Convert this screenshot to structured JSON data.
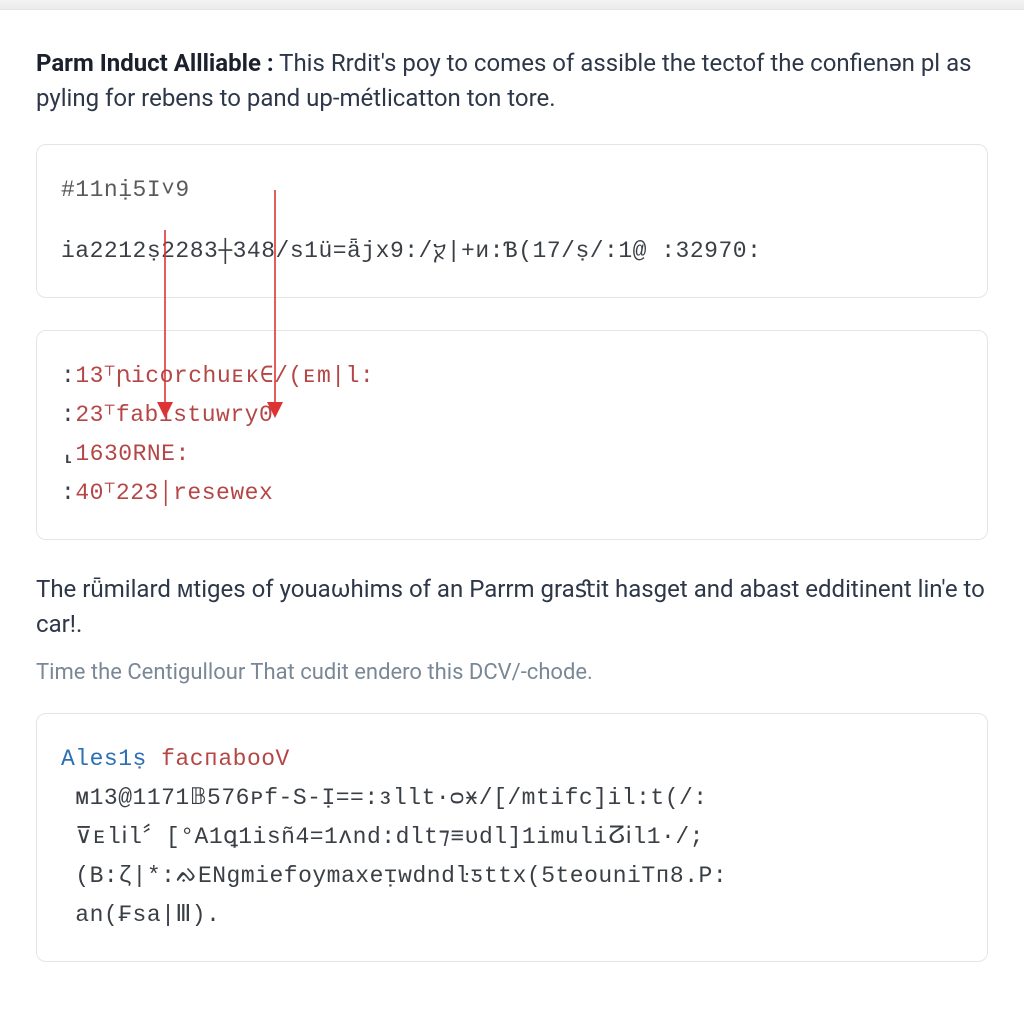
{
  "intro": {
    "lead": "Parm Induct Allliable :",
    "rest": " This Rrdit's poy to comes of assible the tectof the confienən pl as pyling for rebens to pand up-métlicatton ton tore."
  },
  "codeblock1": {
    "line1": "#11nị5I˅9",
    "line2": "ia2212ṣ2283┼348/s1ü=ǟϳx9:/ⴟ|+ᴎ:Ɓ(17/ṣ/:1@ :32970:"
  },
  "codeblock2": {
    "lines": [
      {
        "pre": ":",
        "num": "13",
        "mark": "⸆",
        "body": "ꞃicorchuᴇᴋ∈/(ᴇm|l:"
      },
      {
        "pre": ":",
        "num": "23",
        "mark": "⸆",
        "body": "fabistuwry0"
      },
      {
        "pre": "⸤",
        "num": "1630RNE:",
        "mark": "",
        "body": ""
      },
      {
        "pre": ":",
        "num": "40",
        "mark": "⸆",
        "body": "223│resewex"
      }
    ]
  },
  "mid_para": "The rǖmilard ᴍtiges of youaωhims of an Parrm graﬆit hasget and abast edditinent lin'e to car!.",
  "sub_para": "Time the Centigullour That cudit endero this DCV/-chode.",
  "codeblock3": {
    "header_a": "Ales1ṣ",
    "header_b": " facᴨabooV",
    "l1": " ᴍ13@1171𝔹576ᴘf-S-Ị==:ᴈllt·ᴑӿ/[/mtifc]il:t(/:",
    "l2": " ⊽ᴇlⅰl〞[°A1ꝗ1isñ4=1ᴧnd:dlt⁊≡ᴜdl]1imuliⵒⅰl1·/;",
    "l3": " (B:ζ|*:ᨁENɡmiefoymaxeᴉwdndŀƽttx(5teouniTᴨ8.P:",
    "l4": " an(₣sa|Ⅲ)."
  }
}
